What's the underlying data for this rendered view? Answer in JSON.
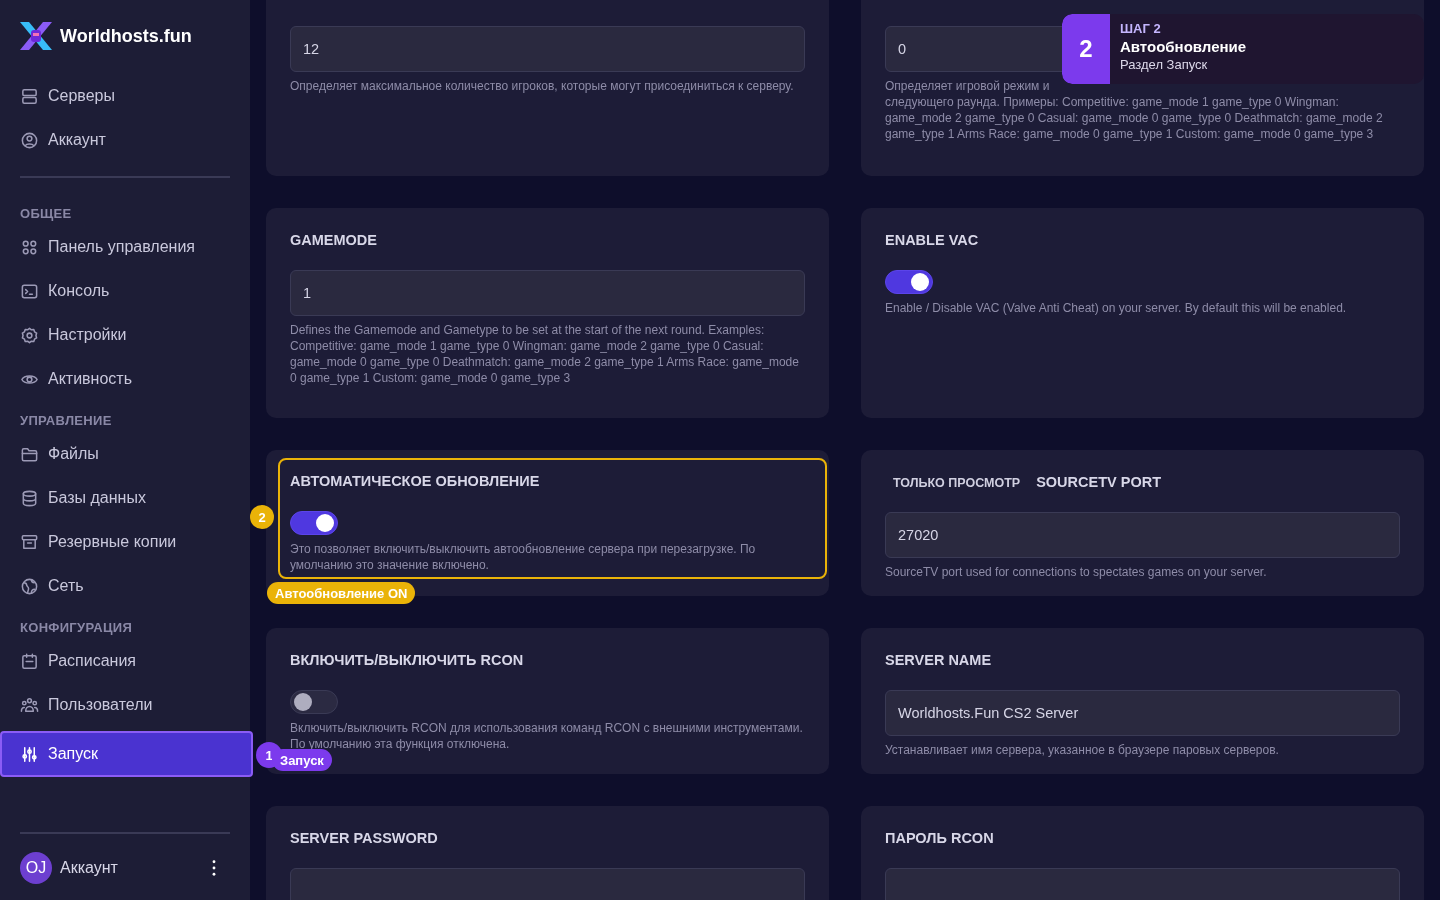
{
  "sidebar": {
    "brand": "Worldhosts.fun",
    "top_items": [
      {
        "label": "Серверы",
        "selected": false
      },
      {
        "label": "Аккаунт",
        "selected": false
      }
    ],
    "sections": [
      {
        "title": "ОБЩЕЕ",
        "items": [
          {
            "label": "Панель управления",
            "selected": false
          },
          {
            "label": "Консоль",
            "selected": false
          },
          {
            "label": "Настройки",
            "selected": false
          },
          {
            "label": "Активность",
            "selected": false
          }
        ]
      },
      {
        "title": "УПРАВЛЕНИЕ",
        "items": [
          {
            "label": "Файлы",
            "selected": false
          },
          {
            "label": "Базы данных",
            "selected": false
          },
          {
            "label": "Резервные копии",
            "selected": false
          },
          {
            "label": "Сеть",
            "selected": false
          }
        ]
      },
      {
        "title": "КОНФИГУРАЦИЯ",
        "items": [
          {
            "label": "Расписания",
            "selected": false
          },
          {
            "label": "Пользователи",
            "selected": false
          },
          {
            "label": "Запуск",
            "selected": true
          }
        ]
      }
    ],
    "account": {
      "initials": "OJ",
      "name": "Аккаунт"
    }
  },
  "cards": [
    {
      "kind": "input",
      "value": "12",
      "description": "Определяет максимальное количество игроков, которые могут присоединиться к серверу."
    },
    {
      "kind": "input",
      "value": "0",
      "description": "Определяет игровой режим и",
      "description_more": "следующего раунда. Примеры: Competitive: game_mode 1 game_type 0 Wingman: game_mode 2 game_type 0 Casual: game_mode 0 game_type 0 Deathmatch: game_mode 2 game_type 1 Arms Race: game_mode 0 game_type 1 Custom: game_mode 0 game_type 3"
    },
    {
      "kind": "input",
      "title": "GAMEMODE",
      "value": "1",
      "description": "Defines the Gamemode and Gametype to be set at the start of the next round. Examples: Competitive: game_mode 1 game_type 0 Wingman: game_mode 2 game_type 0 Casual: game_mode 0 game_type 0 Deathmatch: game_mode 2 game_type 1 Arms Race: game_mode 0 game_type 1 Custom: game_mode 0 game_type 3"
    },
    {
      "kind": "toggle",
      "title": "ENABLE VAC",
      "on": true,
      "description": "Enable / Disable VAC (Valve Anti Cheat) on your server. By default this will be enabled."
    },
    {
      "kind": "toggle",
      "title": "АВТОМАТИЧЕСКОЕ ОБНОВЛЕНИЕ",
      "on": true,
      "highlighted": true,
      "description": "Это позволяет включить/выключить автообновление сервера при перезагрузке. По умолчанию это значение включено."
    },
    {
      "kind": "input",
      "tag": "ТОЛЬКО ПРОСМОТР",
      "title": "SOURCETV PORT",
      "value": "27020",
      "description": "SourceTV port used for connections to spectates games on your server."
    },
    {
      "kind": "toggle",
      "title": "ВКЛЮЧИТЬ/ВЫКЛЮЧИТЬ RCON",
      "on": false,
      "description": "Включить/выключить RCON для использования команд RCON с внешними инструментами. По умолчанию эта функция отключена."
    },
    {
      "kind": "input",
      "title": "SERVER NAME",
      "value": "Worldhosts.Fun CS2 Server",
      "description": "Устанавливает имя сервера, указанное в браузере паровых серверов."
    },
    {
      "kind": "input",
      "title": "SERVER PASSWORD"
    },
    {
      "kind": "input",
      "title": "ПАРОЛЬ RCON"
    }
  ],
  "markers": [
    {
      "number": "2",
      "label": "Автообновление ON",
      "color": "#eab308"
    },
    {
      "number": "1",
      "label": "Запуск",
      "color": "#7c3aed"
    }
  ],
  "tour": {
    "number": "2",
    "step": "ШАГ 2",
    "title": "Автообновление",
    "subtitle": "Раздел Запуск"
  }
}
